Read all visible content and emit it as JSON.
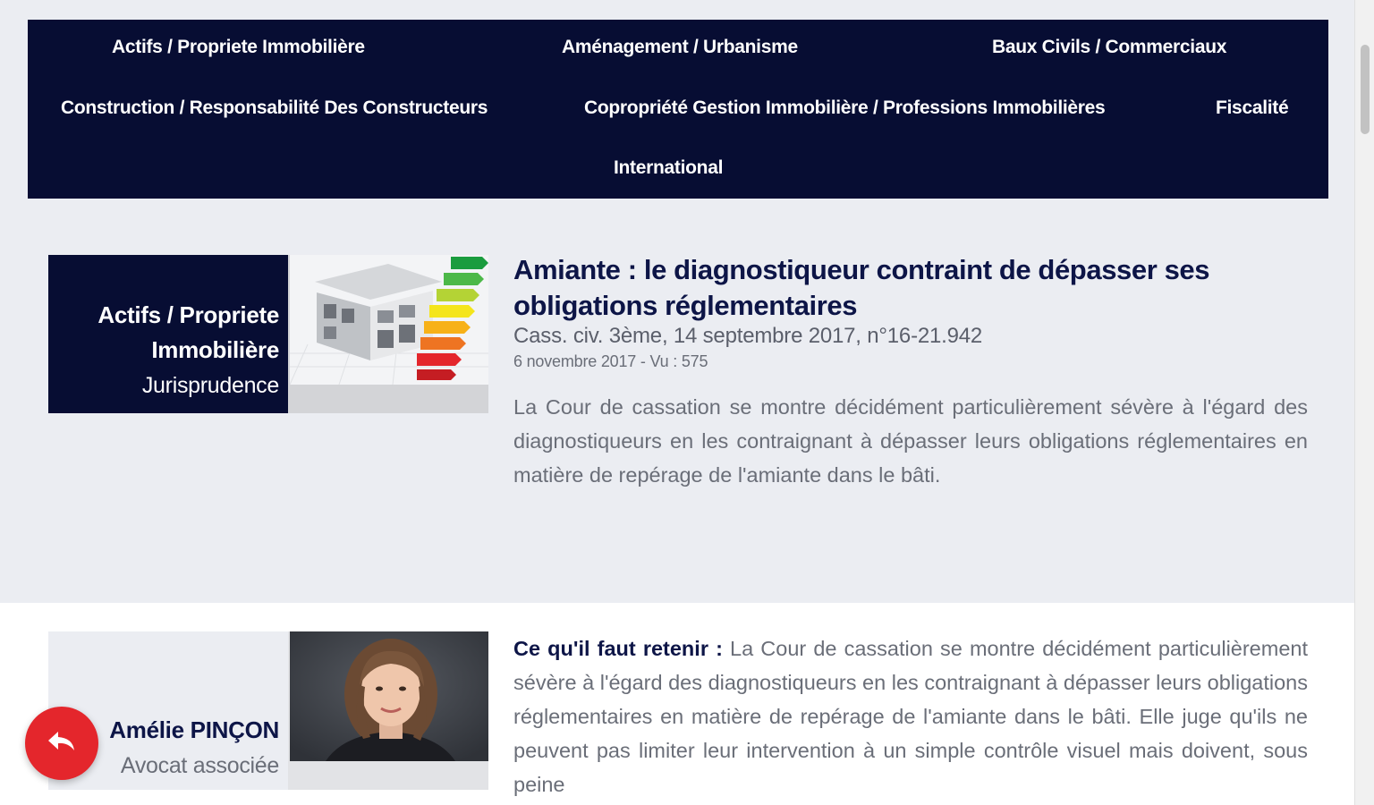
{
  "nav": {
    "items": [
      {
        "label": "Actifs / Propriete Immobilière"
      },
      {
        "label": "Aménagement / Urbanisme"
      },
      {
        "label": "Baux Civils / Commerciaux"
      },
      {
        "label": "Construction / Responsabilité Des Constructeurs"
      },
      {
        "label": "Copropriété Gestion Immobilière / Professions Immobilières"
      },
      {
        "label": "Fiscalité"
      },
      {
        "label": "International"
      }
    ]
  },
  "article": {
    "category_line1": "Actifs / Propriete",
    "category_line2": "Immobilière",
    "category_type": "Jurisprudence",
    "image_icon": "building-energy-label-image",
    "title": "Amiante : le diagnostiqueur contraint de dépasser ses obligations réglementaires",
    "reference": "Cass. civ. 3ème, 14 septembre 2017, n°16-21.942",
    "meta": "6 novembre 2017 - Vu : 575",
    "excerpt": "La Cour de cassation se montre décidément particulièrement sévère à l'égard des diagnostiqueurs en les contraignant à dépasser leurs obligations réglementaires en matière de repérage de l'amiante dans le bâti."
  },
  "author": {
    "name": "Amélie PINÇON",
    "role": "Avocat associée",
    "photo_icon": "author-portrait"
  },
  "body": {
    "lead": "Ce qu'il faut retenir :",
    "text": "La Cour de cassation se montre décidément particulièrement sévère à l'égard des diagnostiqueurs en les contraignant à dépasser leurs obligations réglementaires en matière de repérage de l'amiante dans le bâti. Elle juge qu'ils ne peuvent pas limiter leur intervention à un simple contrôle visuel mais doivent, sous peine"
  },
  "fab": {
    "icon": "reply-arrow-icon"
  },
  "colors": {
    "navy": "#070d33",
    "accent_red": "#e4262c",
    "title_blue": "#0d1547",
    "text_grey": "#6a6e78"
  }
}
